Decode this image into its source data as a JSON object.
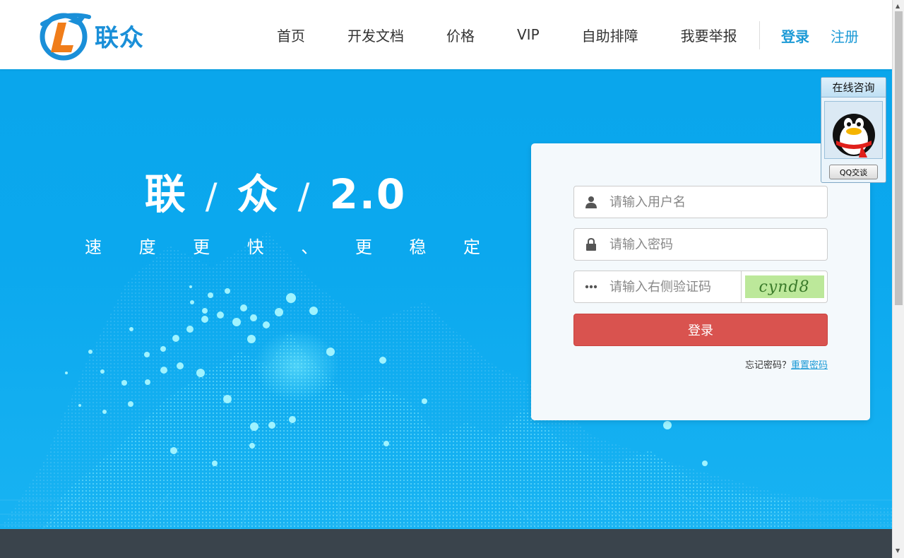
{
  "brand": {
    "name": "联众"
  },
  "nav": {
    "items": [
      "首页",
      "开发文档",
      "价格",
      "VIP",
      "自助排障",
      "我要举报"
    ],
    "login": "登录",
    "register": "注册"
  },
  "hero": {
    "headline_part1": "联",
    "headline_sep": "/",
    "headline_part2": "众",
    "headline_part3": "2.0",
    "tagline_chars": [
      "速",
      "度",
      "更",
      "快",
      "、",
      "更",
      "稳",
      "定"
    ]
  },
  "login_form": {
    "username_placeholder": "请输入用户名",
    "password_placeholder": "请输入密码",
    "captcha_placeholder": "请输入右侧验证码",
    "captcha_text": "cynd8",
    "submit_label": "登录",
    "forgot_text": "忘记密码？",
    "reset_link": "重置密码"
  },
  "qq_widget": {
    "title": "在线咨询",
    "button": "QQ交谈"
  },
  "colors": {
    "primary": "#1c9ad6",
    "hero_bg": "#0aa6ec",
    "login_button": "#d9534f",
    "footer": "#3a444c"
  }
}
